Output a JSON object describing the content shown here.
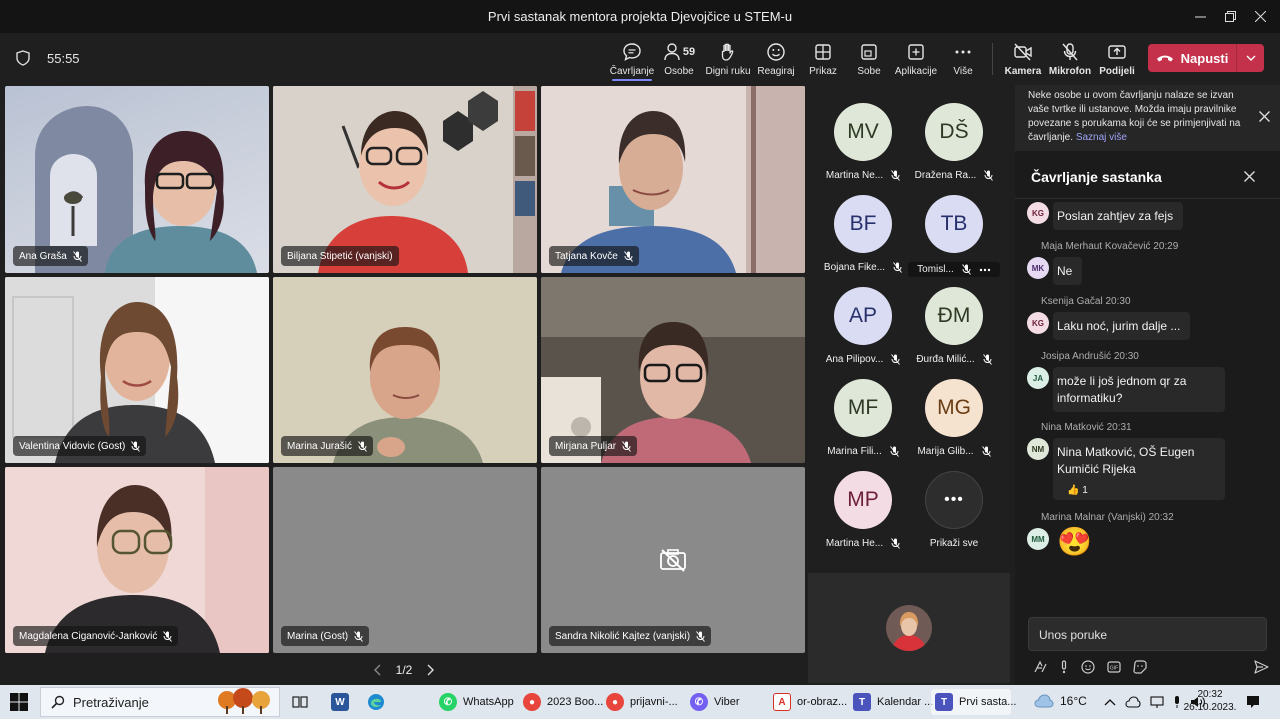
{
  "window": {
    "title": "Prvi sastanak mentora projekta Djevojčice u STEM-u"
  },
  "toolbar": {
    "timer": "55:55",
    "items": [
      {
        "label": "Čavrljanje",
        "icon": "chat-icon"
      },
      {
        "label": "Osobe",
        "icon": "people-icon",
        "count": "59"
      },
      {
        "label": "Digni ruku",
        "icon": "raise-hand-icon"
      },
      {
        "label": "Reagiraj",
        "icon": "smiley-icon"
      },
      {
        "label": "Prikaz",
        "icon": "view-grid-icon"
      },
      {
        "label": "Sobe",
        "icon": "breakout-rooms-icon"
      },
      {
        "label": "Aplikacije",
        "icon": "add-apps-icon"
      },
      {
        "label": "Više",
        "icon": "more-icon"
      },
      {
        "label": "Kamera",
        "icon": "camera-off-icon"
      },
      {
        "label": "Mikrofon",
        "icon": "mic-off-icon"
      },
      {
        "label": "Podijeli",
        "icon": "share-icon"
      }
    ],
    "leave_label": "Napusti"
  },
  "video_tiles": [
    {
      "name": "Ana Graša"
    },
    {
      "name": "Biljana Stipetić (vanjski)"
    },
    {
      "name": "Tatjana Kovče"
    },
    {
      "name": "Valentina Vidovic (Gost)"
    },
    {
      "name": "Marina Jurašić"
    },
    {
      "name": "Mirjana Puljar"
    },
    {
      "name": "Magdalena Ciganović-Janković"
    },
    {
      "name": "Marina (Gost)"
    },
    {
      "name": "Sandra Nikolić Kajtez (vanjski)"
    }
  ],
  "pager": {
    "label": "1/2"
  },
  "roster": [
    {
      "initials": "MV",
      "name": "Martina Ne...",
      "bg": "#dfe8d8",
      "fg": "#2e3a24"
    },
    {
      "initials": "DŠ",
      "name": "Dražena Ra...",
      "bg": "#dfe8d8",
      "fg": "#2e3a24"
    },
    {
      "initials": "BF",
      "name": "Bojana Fike...",
      "bg": "#d9dcf3",
      "fg": "#28306b"
    },
    {
      "initials": "TB",
      "name": "Tomisl...",
      "bg": "#d9dcf3",
      "fg": "#28306b"
    },
    {
      "initials": "AP",
      "name": "Ana Pilipov...",
      "bg": "#d9dcf3",
      "fg": "#28306b"
    },
    {
      "initials": "ĐM",
      "name": "Đurđa Milić...",
      "bg": "#dfe8d8",
      "fg": "#2e3a24"
    },
    {
      "initials": "MF",
      "name": "Marina Fili...",
      "bg": "#dfe8d8",
      "fg": "#2e3a24"
    },
    {
      "initials": "MG",
      "name": "Marija Glib...",
      "bg": "#f6e3cf",
      "fg": "#6b3d14"
    },
    {
      "initials": "MP",
      "name": "Martina He...",
      "bg": "#f4dce4",
      "fg": "#6b1f3a"
    },
    {
      "initials": "•••",
      "name": "Prikaži sve",
      "bg": "#2d2d2d",
      "fg": "#ffffff"
    }
  ],
  "chat": {
    "notice": "Neke osobe u ovom čavrljanju nalaze se izvan vaše tvrtke ili ustanove. Možda imaju pravilnike povezane s porukama koji će se primjenjivati na čavrljanje.",
    "notice_link": "Saznaj više",
    "title": "Čavrljanje sastanka",
    "messages": [
      {
        "initials": "KG",
        "sender": "",
        "text": "Poslan zahtjev za fejs",
        "avatar_bg": "#f4dce4",
        "avatar_fg": "#6b1f3a"
      },
      {
        "initials": "MK",
        "sender": "Maja Merhaut Kovačević   20:29",
        "text": "Ne",
        "avatar_bg": "#e6d9f3",
        "avatar_fg": "#4a2d6b"
      },
      {
        "initials": "KG",
        "sender": "Ksenija Gačal   20:30",
        "text": "Laku noć, jurim dalje ...",
        "avatar_bg": "#f4dce4",
        "avatar_fg": "#6b1f3a"
      },
      {
        "initials": "JA",
        "sender": "Josipa Andrušić   20:30",
        "text": "može li još jednom qr za informatiku?",
        "avatar_bg": "#dcefe6",
        "avatar_fg": "#1f5a3d"
      },
      {
        "initials": "NM",
        "sender": "Nina Matković   20:31",
        "text": "Nina Matković, OŠ Eugen Kumičić Rijeka",
        "avatar_bg": "#dfe8d8",
        "avatar_fg": "#2e3a24",
        "reaction": "👍 1"
      },
      {
        "initials": "MM",
        "sender": "Marina Malnar (Vanjski)   20:32",
        "text": "😍",
        "avatar_bg": "#dcefe6",
        "avatar_fg": "#1f5a3d"
      }
    ],
    "compose_placeholder": "Unos poruke"
  },
  "taskbar": {
    "search": "Pretraživanje",
    "apps": [
      {
        "label": "WhatsApp",
        "color": "#25d366"
      },
      {
        "label": "2023 Boo...",
        "color": "#e8453c"
      },
      {
        "label": "prijavni-...",
        "color": "#e8453c"
      },
      {
        "label": "Viber",
        "color": "#7360f2"
      },
      {
        "label": "or-obraz...",
        "color": "#d93025"
      },
      {
        "label": "Kalendar ...",
        "color": "#4b53bc"
      },
      {
        "label": "Prvi sasta...",
        "color": "#4b53bc"
      }
    ],
    "temperature": "16°C",
    "time": "20:32",
    "date": "26.10.2023."
  }
}
